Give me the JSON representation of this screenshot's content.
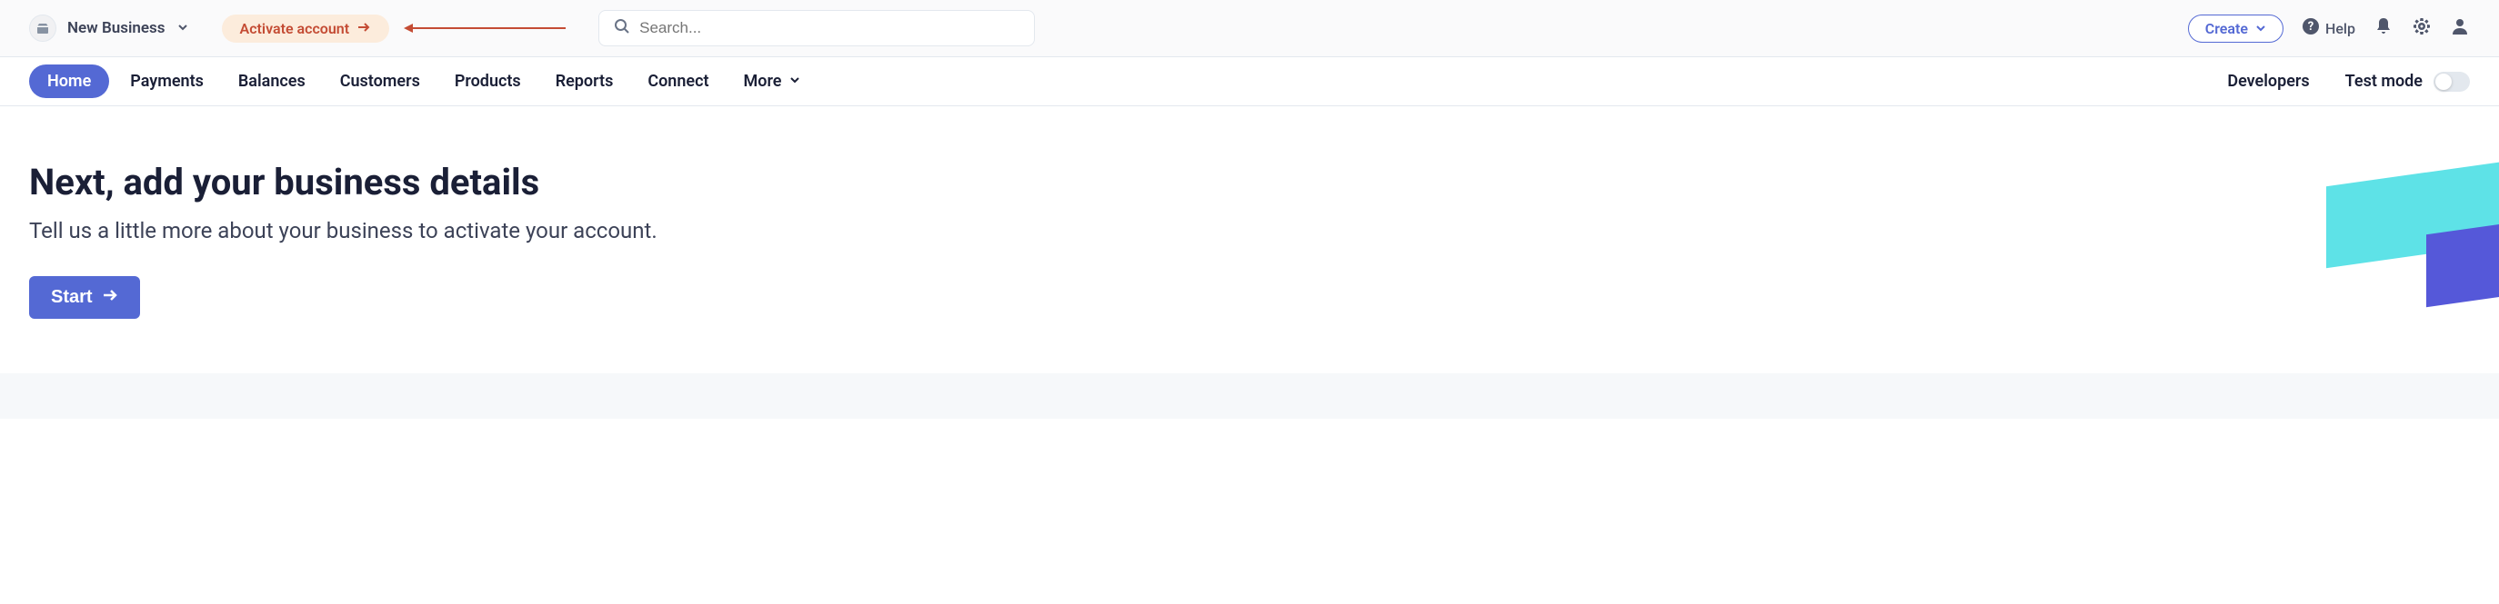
{
  "header": {
    "business_name": "New Business",
    "activate_label": "Activate account",
    "search_placeholder": "Search...",
    "create_label": "Create",
    "help_label": "Help"
  },
  "nav": {
    "items": [
      {
        "label": "Home",
        "active": true
      },
      {
        "label": "Payments",
        "active": false
      },
      {
        "label": "Balances",
        "active": false
      },
      {
        "label": "Customers",
        "active": false
      },
      {
        "label": "Products",
        "active": false
      },
      {
        "label": "Reports",
        "active": false
      },
      {
        "label": "Connect",
        "active": false
      },
      {
        "label": "More",
        "active": false
      }
    ],
    "developers_label": "Developers",
    "test_mode_label": "Test mode"
  },
  "main": {
    "title": "Next, add your business details",
    "subtitle": "Tell us a little more about your business to activate your account.",
    "start_button": "Start"
  }
}
